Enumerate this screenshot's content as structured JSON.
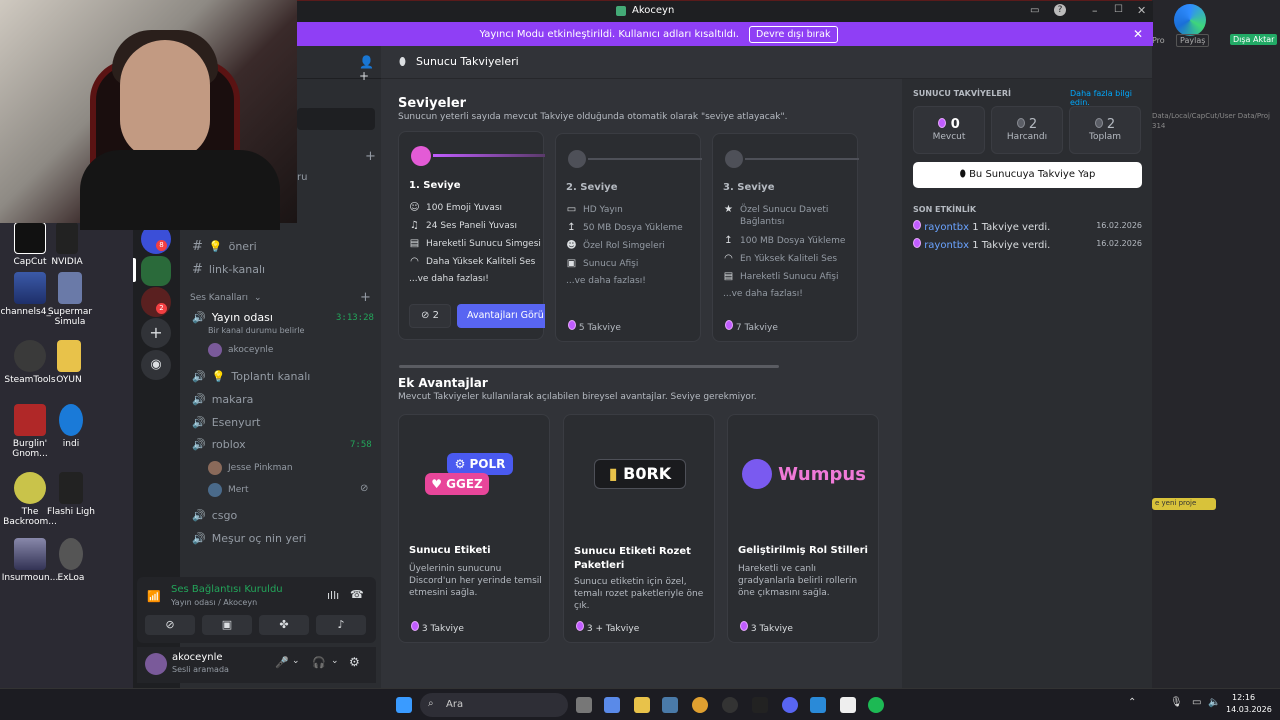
{
  "window": {
    "title": "Akoceyn"
  },
  "banner": {
    "text": "Yayıncı Modu etkinleştirildi. Kullanıcı adları kısaltıldı.",
    "button": "Devre dışı bırak"
  },
  "page": {
    "title": "Sunucu Takviyeleri"
  },
  "levels": {
    "title": "Seviyeler",
    "subtitle": "Sunucun yeterli sayıda mevcut Takviye olduğunda otomatik olarak \"seviye atlayacak\".",
    "items": [
      {
        "name": "1. Seviye",
        "perks": [
          "100 Emoji Yuvası",
          "24 Ses Paneli Yuvası",
          "Hareketli Sunucu Simgesi",
          "Daha Yüksek Kaliteli Ses"
        ],
        "more": "...ve daha fazlası!",
        "count": "2",
        "button": "Avantajları Görü"
      },
      {
        "name": "2. Seviye",
        "perks": [
          "HD Yayın",
          "50 MB Dosya Yükleme",
          "Özel Rol Simgeleri",
          "Sunucu Afişi"
        ],
        "more": "...ve daha fazlası!",
        "cost": "5 Takviye"
      },
      {
        "name": "3. Seviye",
        "perks": [
          "Özel Sunucu Daveti Bağlantısı",
          "100 MB Dosya Yükleme",
          "En Yüksek Kaliteli Ses",
          "Hareketli Sunucu Afişi"
        ],
        "more": "...ve daha fazlası!",
        "cost": "7 Takviye"
      }
    ]
  },
  "extras": {
    "title": "Ek Avantajlar",
    "subtitle": "Mevcut Takviyeler kullanılarak açılabilen bireysel avantajlar. Seviye gerekmiyor.",
    "items": [
      {
        "name": "Sunucu Etiketi",
        "desc": "Üyelerinin sunucunu Discord'un her yerinde temsil etmesini sağla.",
        "cost": "3 Takviye",
        "art1": "POLR",
        "art2": "GGEZ"
      },
      {
        "name": "Sunucu Etiketi Rozet Paketleri",
        "desc": "Sunucu etiketin için özel, temalı rozet paketleriyle öne çık.",
        "cost": "3 + Takviye",
        "art1": "B0RK"
      },
      {
        "name": "Geliştirilmiş Rol Stilleri",
        "desc": "Hareketli ve canlı gradyanlarla belirli rollerin öne çıkmasını sağla.",
        "cost": "3 Takviye",
        "art1": "Wumpus"
      }
    ]
  },
  "side": {
    "title": "SUNUCU TAKVİYELERİ",
    "link": "Daha fazla bilgi edin.",
    "stats": [
      {
        "value": "0",
        "label": "Mevcut"
      },
      {
        "value": "2",
        "label": "Harcandı"
      },
      {
        "value": "2",
        "label": "Toplam"
      }
    ],
    "boost_button": "Bu Sunucuya Takviye Yap",
    "activity_title": "SON ETKİNLİK",
    "activity": [
      {
        "user": "rayontbx",
        "text": "1 Takviye verdi.",
        "date": "16.02.2026"
      },
      {
        "user": "rayontbx",
        "text": "1 Takviye verdi.",
        "date": "16.02.2026"
      }
    ]
  },
  "channels": {
    "partial": "ru",
    "partial2": "foto-video",
    "text": [
      "öneri",
      "link-kanalı"
    ],
    "voice_header": "Ses Kanalları",
    "voice_live": {
      "name": "Yayın odası",
      "time": "3:13:28",
      "status": "Bir kanal durumu belirle",
      "user": "akoceynle"
    },
    "voice": [
      "Toplantı kanalı",
      "makara",
      "Esenyurt"
    ],
    "roblox": {
      "name": "roblox",
      "time": "7:58",
      "users": [
        "Jesse Pinkman",
        "Mert"
      ]
    },
    "voice2": [
      "csgo",
      "Meşur oç nin yeri"
    ]
  },
  "voicepanel": {
    "status": "Ses Bağlantısı Kuruldu",
    "channel": "Yayın odası / Akoceyn"
  },
  "user": {
    "name": "akoceynle",
    "status": "Sesli aramada"
  },
  "desktop": {
    "icons": [
      "CapCut",
      "NVIDIA",
      "channels4_...",
      "Supermar Simula",
      "SteamTools",
      "OYUN",
      "Burglin' Gnom...",
      "indi",
      "The Backroom...",
      "Flashi Ligh",
      "Insurmoun...",
      "ExLoa"
    ]
  },
  "taskbar": {
    "search": "Ara",
    "time": "12:16",
    "date": "14.03.2026"
  },
  "rightapp": {
    "btn1": "Pro",
    "btn2": "Paylaş",
    "btn3": "Dışa Aktar",
    "path": "Data/Local/CapCut/User Data/Proj",
    "num": "314",
    "chip": "e yeni proje"
  }
}
